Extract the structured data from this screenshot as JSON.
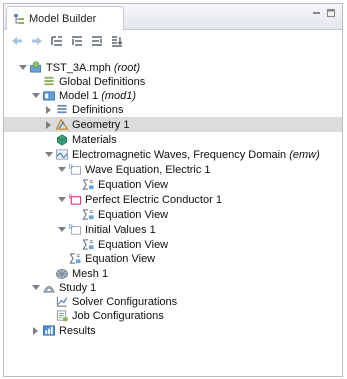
{
  "panel": {
    "title": "Model Builder"
  },
  "tree": [
    {
      "id": "root",
      "label": "TST_3A.mph ",
      "tag": "(root)",
      "indent": 0,
      "expander": "open",
      "icon": "model-file-icon"
    },
    {
      "id": "global",
      "label": "Global Definitions",
      "tag": "",
      "indent": 1,
      "expander": "none",
      "icon": "global-definitions-icon"
    },
    {
      "id": "model1",
      "label": "Model 1 ",
      "tag": "(mod1)",
      "indent": 1,
      "expander": "open",
      "icon": "model-icon"
    },
    {
      "id": "defs",
      "label": "Definitions",
      "tag": "",
      "indent": 2,
      "expander": "closed",
      "icon": "definitions-icon"
    },
    {
      "id": "geom",
      "label": "Geometry 1",
      "tag": "",
      "indent": 2,
      "expander": "closed",
      "icon": "geometry-icon",
      "selected": true
    },
    {
      "id": "mat",
      "label": "Materials",
      "tag": "",
      "indent": 2,
      "expander": "none",
      "icon": "materials-icon"
    },
    {
      "id": "emw",
      "label": "Electromagnetic Waves, Frequency Domain ",
      "tag": "(emw)",
      "indent": 2,
      "expander": "open",
      "icon": "physics-icon"
    },
    {
      "id": "wave",
      "label": "Wave Equation, Electric 1",
      "tag": "",
      "indent": 3,
      "expander": "open",
      "icon": "domain-feature-icon"
    },
    {
      "id": "eqv1",
      "label": "Equation View",
      "tag": "",
      "indent": 4,
      "expander": "none",
      "icon": "equation-view-icon"
    },
    {
      "id": "pec",
      "label": "Perfect Electric Conductor 1",
      "tag": "",
      "indent": 3,
      "expander": "open",
      "icon": "boundary-feature-icon"
    },
    {
      "id": "eqv2",
      "label": "Equation View",
      "tag": "",
      "indent": 4,
      "expander": "none",
      "icon": "equation-view-icon"
    },
    {
      "id": "init",
      "label": "Initial Values 1",
      "tag": "",
      "indent": 3,
      "expander": "open",
      "icon": "domain-feature-icon"
    },
    {
      "id": "eqv3",
      "label": "Equation View",
      "tag": "",
      "indent": 4,
      "expander": "none",
      "icon": "equation-view-icon"
    },
    {
      "id": "eqv4",
      "label": "Equation View",
      "tag": "",
      "indent": 3,
      "expander": "none",
      "icon": "equation-view-icon"
    },
    {
      "id": "mesh",
      "label": "Mesh 1",
      "tag": "",
      "indent": 2,
      "expander": "none",
      "icon": "mesh-icon"
    },
    {
      "id": "study",
      "label": "Study 1",
      "tag": "",
      "indent": 1,
      "expander": "open",
      "icon": "study-icon"
    },
    {
      "id": "solver",
      "label": "Solver Configurations",
      "tag": "",
      "indent": 2,
      "expander": "none",
      "icon": "solver-configurations-icon"
    },
    {
      "id": "job",
      "label": "Job Configurations",
      "tag": "",
      "indent": 2,
      "expander": "none",
      "icon": "job-configurations-icon"
    },
    {
      "id": "results",
      "label": "Results",
      "tag": "",
      "indent": 1,
      "expander": "closed",
      "icon": "results-icon"
    }
  ]
}
